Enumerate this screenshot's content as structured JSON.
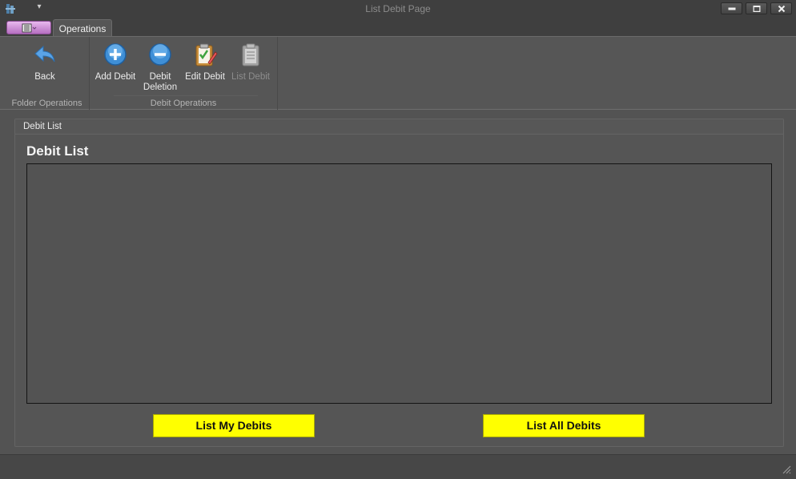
{
  "window": {
    "title": "List Debit Page",
    "quick_access_arrow": "▾",
    "icons": {
      "app": "app-icon",
      "minimize": "minimize-icon",
      "maximize": "maximize-icon",
      "close": "close-icon"
    }
  },
  "tabs": [
    {
      "label": "Operations",
      "selected": true
    }
  ],
  "ribbon": {
    "groups": [
      {
        "label": "Folder Operations",
        "buttons": [
          {
            "label": "Back",
            "icon": "back-arrow-icon",
            "enabled": true
          }
        ]
      },
      {
        "label": "Debit Operations",
        "buttons": [
          {
            "label": "Add Debit",
            "icon": "add-icon",
            "enabled": true
          },
          {
            "label": "Debit\nDeletion",
            "label_line1": "Debit",
            "label_line2": "Deletion",
            "icon": "remove-icon",
            "enabled": true
          },
          {
            "label": "Edit Debit",
            "icon": "edit-clipboard-icon",
            "enabled": true
          },
          {
            "label": "List Debit",
            "icon": "clipboard-list-icon",
            "enabled": false
          }
        ]
      }
    ]
  },
  "main": {
    "groupbox_caption": "Debit List",
    "title": "Debit List",
    "grid_rows": [],
    "buttons": {
      "list_my": "List My Debits",
      "list_all": "List All Debits"
    }
  },
  "colors": {
    "background": "#535353",
    "titlebar": "#3f3f3f",
    "action_button": "#ffff00",
    "app_menu": "#d49ad9"
  }
}
